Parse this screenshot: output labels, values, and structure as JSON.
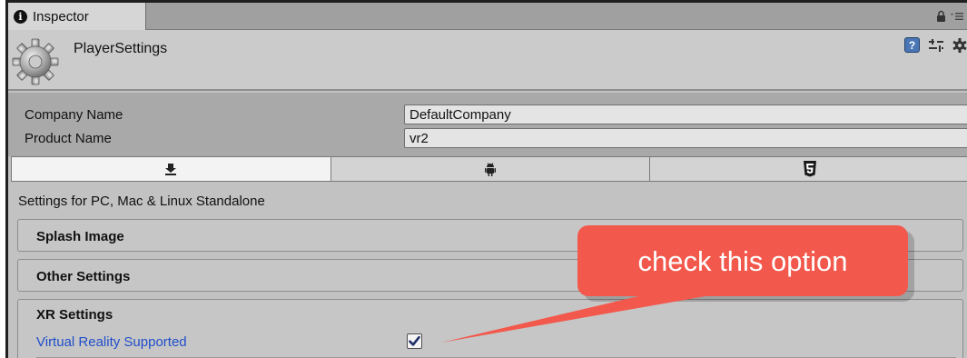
{
  "window": {
    "tab_title": "Inspector",
    "tab_icon": "info-icon"
  },
  "header": {
    "title": "PlayerSettings",
    "icons": [
      "settings-gear-icon",
      "help-icon",
      "presets-icon",
      "component-menu-gear-icon"
    ]
  },
  "fields": [
    {
      "label": "Company Name",
      "value": "DefaultCompany"
    },
    {
      "label": "Product Name",
      "value": "vr2"
    }
  ],
  "platform_tabs": [
    {
      "icon": "standalone-download-icon",
      "active": true
    },
    {
      "icon": "android-icon",
      "active": false
    },
    {
      "icon": "html5-icon",
      "active": false
    }
  ],
  "settings_for": "Settings for PC, Mac & Linux Standalone",
  "sections": {
    "splash": "Splash Image",
    "other": "Other Settings",
    "xr": "XR Settings"
  },
  "xr": {
    "vr_supported_label": "Virtual Reality Supported",
    "vr_supported_checked": true
  },
  "annotation": {
    "text": "check this option",
    "color": "#f3584c"
  },
  "colors": {
    "link_label": "#1f4fc9",
    "panel_bg": "#c2c2c2"
  }
}
